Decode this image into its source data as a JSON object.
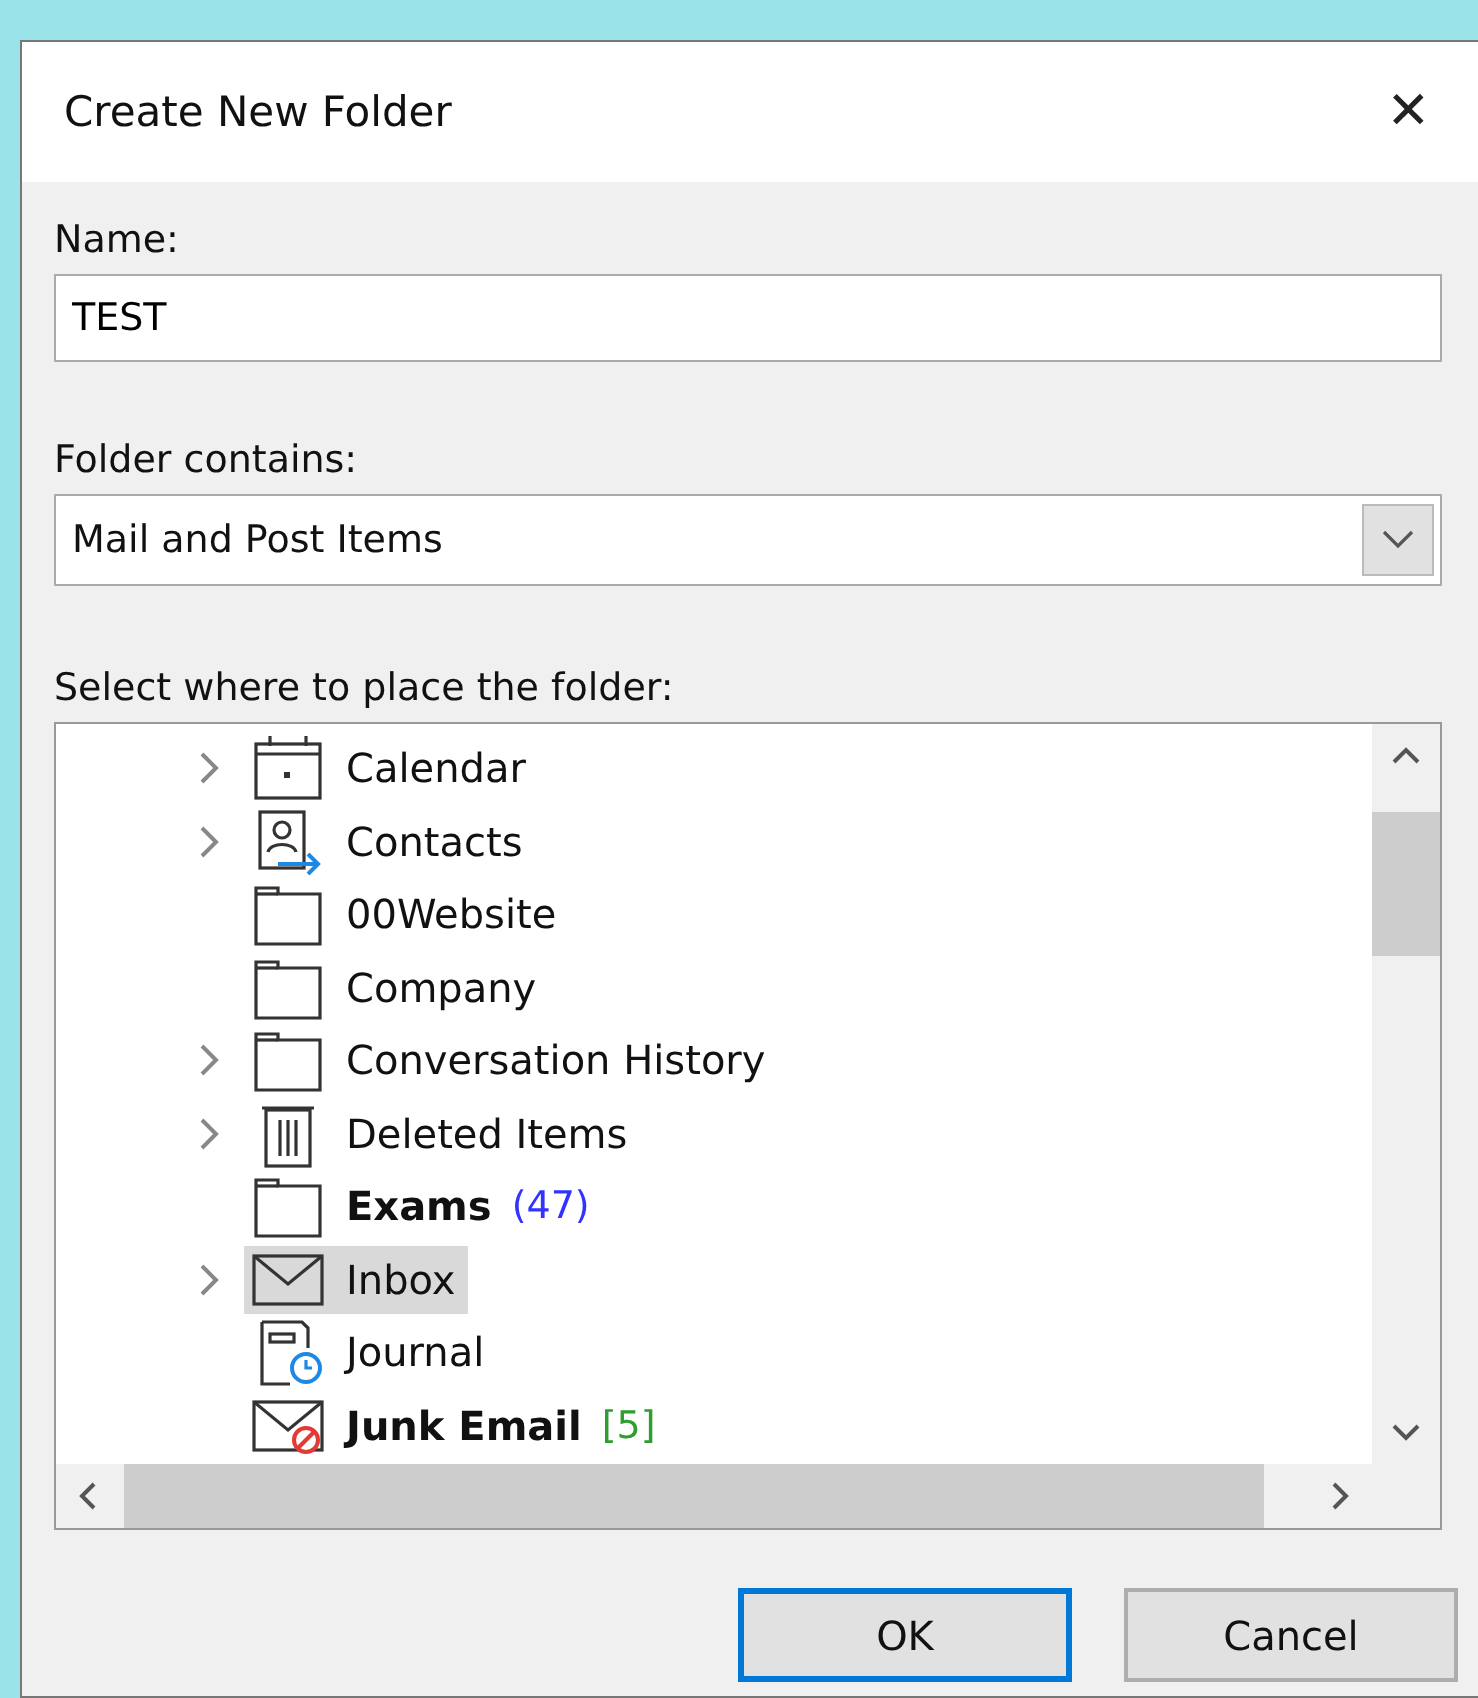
{
  "window": {
    "title": "Create New Folder",
    "close": "✕"
  },
  "name_field": {
    "label": "Name:",
    "value": "TEST"
  },
  "contains_field": {
    "label": "Folder contains:",
    "value": "Mail and Post Items"
  },
  "tree": {
    "label": "Select where to place the folder:",
    "items": [
      {
        "name": "Calendar",
        "kind": "calendar",
        "expandable": true,
        "bold": false,
        "selected": false
      },
      {
        "name": "Contacts",
        "kind": "contacts",
        "expandable": true,
        "bold": false,
        "selected": false
      },
      {
        "name": "00Website",
        "kind": "folder",
        "expandable": false,
        "bold": false,
        "selected": false
      },
      {
        "name": "Company",
        "kind": "folder",
        "expandable": false,
        "bold": false,
        "selected": false
      },
      {
        "name": "Conversation History",
        "kind": "folder",
        "expandable": true,
        "bold": false,
        "selected": false
      },
      {
        "name": "Deleted Items",
        "kind": "trash",
        "expandable": true,
        "bold": false,
        "selected": false
      },
      {
        "name": "Exams",
        "kind": "folder",
        "expandable": false,
        "bold": true,
        "count": "(47)",
        "color": "#3333ff",
        "selected": false
      },
      {
        "name": "Inbox",
        "kind": "mail",
        "expandable": true,
        "bold": false,
        "selected": true
      },
      {
        "name": "Journal",
        "kind": "journal",
        "expandable": false,
        "bold": false,
        "selected": false
      },
      {
        "name": "Junk Email",
        "kind": "junk",
        "expandable": false,
        "bold": true,
        "count": "[5]",
        "color": "#2e9e2e",
        "selected": false
      }
    ]
  },
  "buttons": [
    {
      "label": "OK",
      "default": true
    },
    {
      "label": "Cancel",
      "default": false
    }
  ]
}
